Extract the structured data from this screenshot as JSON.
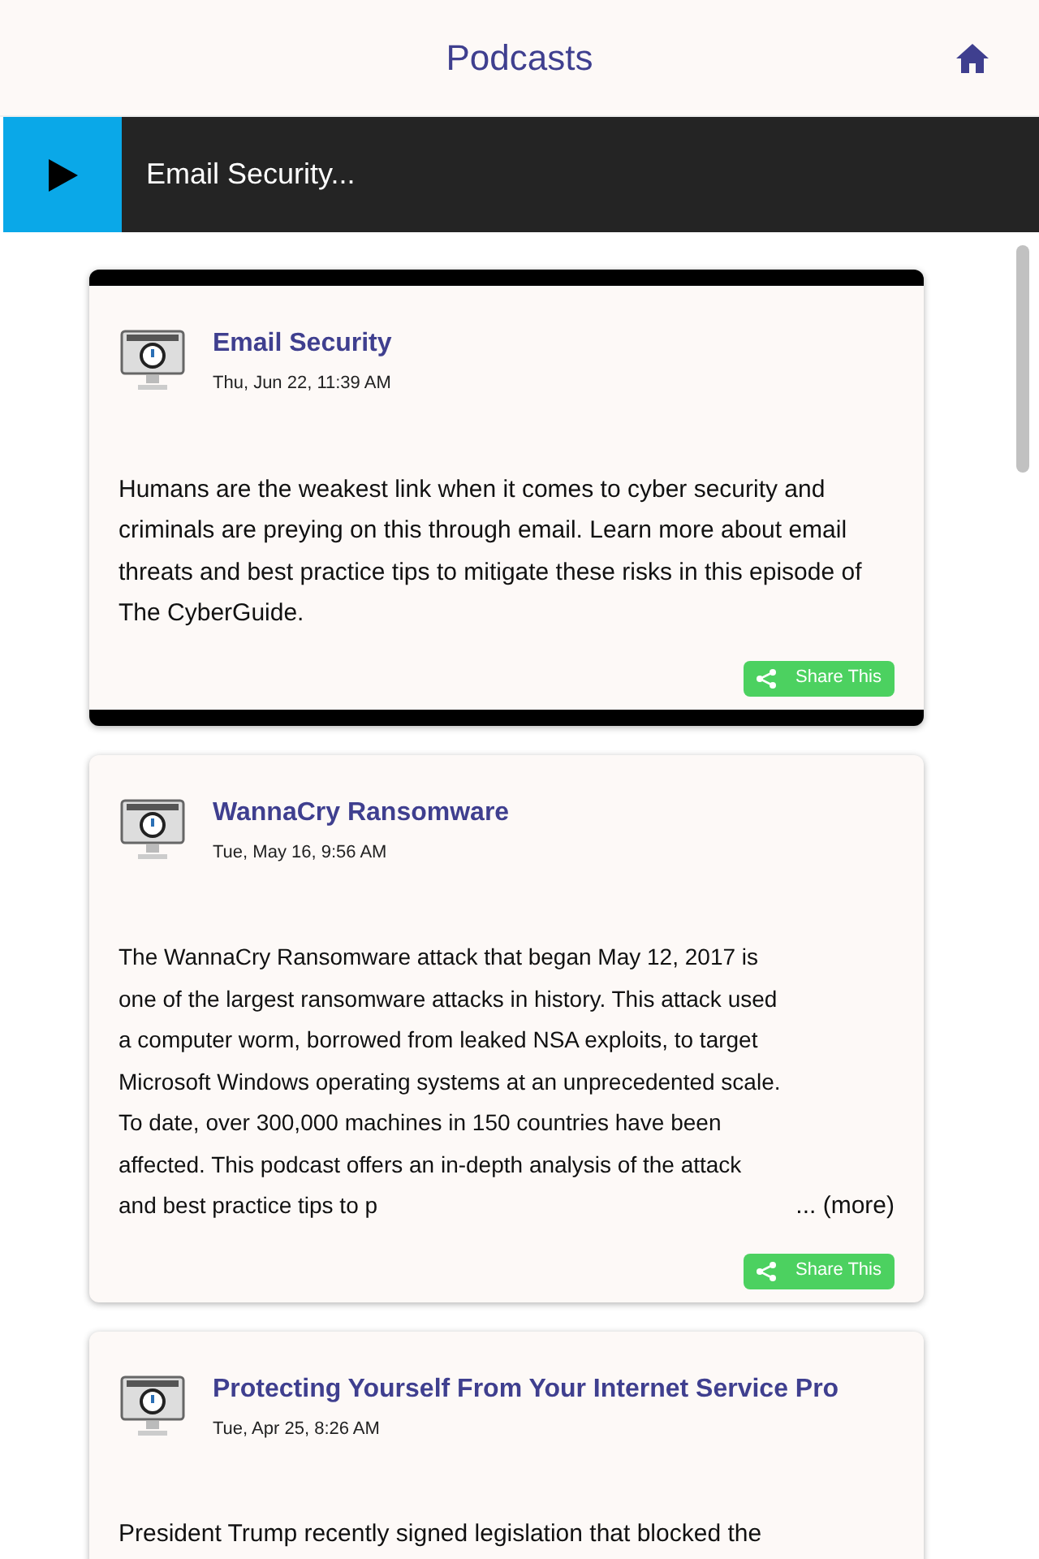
{
  "header": {
    "title": "Podcasts"
  },
  "player": {
    "now_playing": "Email Security..."
  },
  "episodes": [
    {
      "title": "Email Security",
      "date": "Thu, Jun 22, 11:39 AM",
      "playing": true,
      "description": "Humans are the weakest link when it comes to cyber security and criminals are preying on this through email. Learn more about email threats and best practice tips to mitigate these risks in this episode of The CyberGuide.",
      "share": "Share This"
    },
    {
      "title": "WannaCry Ransomware",
      "date": "Tue, May 16, 9:56 AM",
      "playing": false,
      "description": "The WannaCry Ransomware attack that began May 12, 2017 is one of the largest ransomware attacks in history. This attack used a computer worm, borrowed from leaked NSA exploits, to target Microsoft Windows operating systems at an unprecedented scale. To date, over 300,000 machines in 150 countries have been affected. This podcast offers an in-depth analysis of the attack and best practice tips to p",
      "more": "... (more)",
      "share": "Share This"
    },
    {
      "title": "Protecting Yourself From Your Internet Service Pro",
      "date": "Tue, Apr 25, 8:26 AM",
      "playing": false,
      "description": "President Trump recently signed legislation that blocked the"
    }
  ]
}
